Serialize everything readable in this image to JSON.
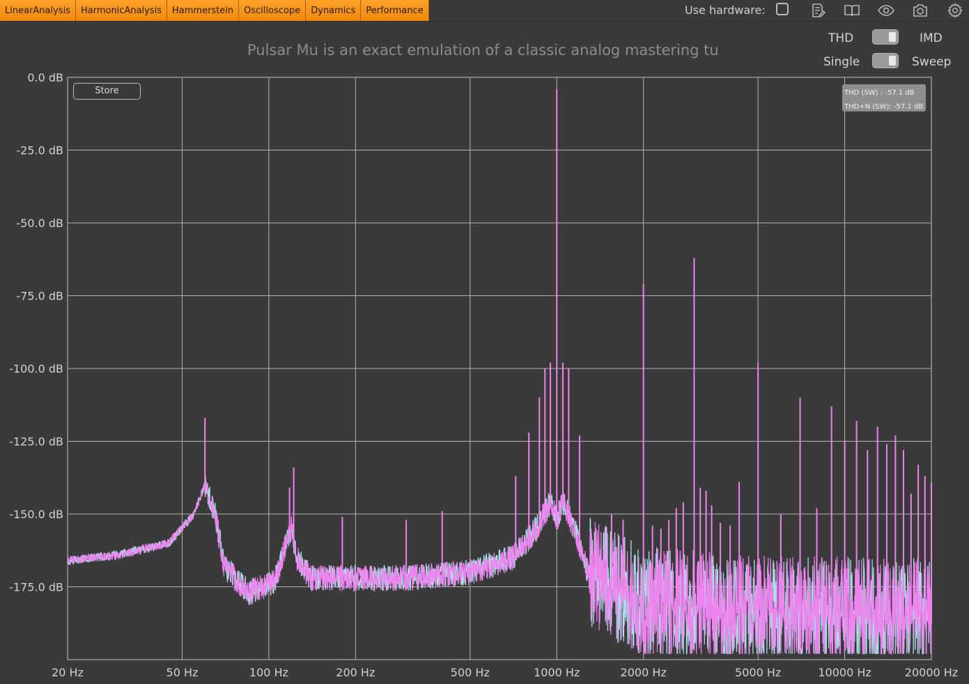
{
  "tabs": [
    "LinearAnalysis",
    "HarmonicAnalysis",
    "Hammerstein",
    "Oscilloscope",
    "Dynamics",
    "Performance"
  ],
  "toolbar": {
    "hardware_label": "Use hardware:",
    "hardware_checked": false,
    "icons": [
      "notes-edit-icon",
      "book-icon",
      "eye-icon",
      "camera-icon",
      "gear-icon"
    ]
  },
  "subtitle": "Pulsar Mu is an exact emulation of a classic analog mastering tu",
  "mode": {
    "left": "THD",
    "right": "IMD",
    "value": "IMD"
  },
  "measure": {
    "left": "Single",
    "right": "Sweep",
    "value": "Sweep"
  },
  "store_label": "Store",
  "readout": {
    "thd": "THD (SW) : -57.1 dB",
    "thdn": "THD+N (SW): -57.1 dB"
  },
  "colors": {
    "background": "#3a3a3a",
    "grid": "#b4b4b4",
    "trace_pink": "#ee82ee",
    "trace_cyan": "#a8e2e6",
    "accent": "#f7941d"
  },
  "chart_data": {
    "type": "line",
    "x_scale": "log",
    "xlim": [
      20,
      20000
    ],
    "ylim": [
      -200,
      0
    ],
    "x_ticks": [
      20,
      50,
      100,
      200,
      500,
      1000,
      2000,
      5000,
      10000,
      20000
    ],
    "x_tick_labels": [
      "20 Hz",
      "50 Hz",
      "100 Hz",
      "200 Hz",
      "500 Hz",
      "1000 Hz",
      "2000 Hz",
      "5000 Hz",
      "10000 Hz",
      "20000 Hz"
    ],
    "y_ticks": [
      0,
      -25,
      -50,
      -75,
      -100,
      -125,
      -150,
      -175
    ],
    "y_tick_labels": [
      "0.0 dB",
      "-25.0 dB",
      "-50.0 dB",
      "-75.0 dB",
      "-100.0 dB",
      "-125.0 dB",
      "-150.0 dB",
      "-175.0 dB"
    ],
    "grid": true,
    "series": [
      {
        "color": "#a8e2e6"
      },
      {
        "color": "#ee82ee"
      }
    ],
    "floor": [
      [
        20,
        -166
      ],
      [
        30,
        -164
      ],
      [
        45,
        -160
      ],
      [
        55,
        -150
      ],
      [
        60,
        -140
      ],
      [
        65,
        -150
      ],
      [
        70,
        -168
      ],
      [
        85,
        -177
      ],
      [
        105,
        -173
      ],
      [
        115,
        -160
      ],
      [
        120,
        -155
      ],
      [
        125,
        -165
      ],
      [
        140,
        -172
      ],
      [
        300,
        -172
      ],
      [
        500,
        -170
      ],
      [
        700,
        -165
      ],
      [
        850,
        -155
      ],
      [
        950,
        -146
      ],
      [
        1000,
        -152
      ],
      [
        1050,
        -146
      ],
      [
        1150,
        -155
      ],
      [
        1300,
        -172
      ],
      [
        2000,
        -182
      ],
      [
        5000,
        -185
      ],
      [
        20000,
        -186
      ]
    ],
    "peaks": [
      {
        "x": 60,
        "y": -117
      },
      {
        "x": 118,
        "y": -141
      },
      {
        "x": 122,
        "y": -134
      },
      {
        "x": 180,
        "y": -151
      },
      {
        "x": 300,
        "y": -152
      },
      {
        "x": 400,
        "y": -149
      },
      {
        "x": 720,
        "y": -137
      },
      {
        "x": 800,
        "y": -122
      },
      {
        "x": 870,
        "y": -110
      },
      {
        "x": 910,
        "y": -100
      },
      {
        "x": 950,
        "y": -98
      },
      {
        "x": 1000,
        "y": -4
      },
      {
        "x": 1050,
        "y": -98
      },
      {
        "x": 1100,
        "y": -100
      },
      {
        "x": 1200,
        "y": -123
      },
      {
        "x": 1550,
        "y": -150
      },
      {
        "x": 1700,
        "y": -152
      },
      {
        "x": 2000,
        "y": -71
      },
      {
        "x": 2150,
        "y": -154
      },
      {
        "x": 2300,
        "y": -155
      },
      {
        "x": 2450,
        "y": -152
      },
      {
        "x": 2600,
        "y": -148
      },
      {
        "x": 2750,
        "y": -146
      },
      {
        "x": 3000,
        "y": -62
      },
      {
        "x": 3150,
        "y": -141
      },
      {
        "x": 3300,
        "y": -142
      },
      {
        "x": 3450,
        "y": -147
      },
      {
        "x": 3700,
        "y": -153
      },
      {
        "x": 4000,
        "y": -154
      },
      {
        "x": 4300,
        "y": -139
      },
      {
        "x": 5000,
        "y": -98
      },
      {
        "x": 6000,
        "y": -150
      },
      {
        "x": 7000,
        "y": -110
      },
      {
        "x": 8000,
        "y": -148
      },
      {
        "x": 9000,
        "y": -113
      },
      {
        "x": 10000,
        "y": -125
      },
      {
        "x": 11000,
        "y": -118
      },
      {
        "x": 12000,
        "y": -128
      },
      {
        "x": 13000,
        "y": -120
      },
      {
        "x": 14000,
        "y": -126
      },
      {
        "x": 15000,
        "y": -123
      },
      {
        "x": 16000,
        "y": -128
      },
      {
        "x": 17000,
        "y": -143
      },
      {
        "x": 18000,
        "y": -133
      },
      {
        "x": 19000,
        "y": -137
      },
      {
        "x": 20000,
        "y": -139
      }
    ]
  }
}
